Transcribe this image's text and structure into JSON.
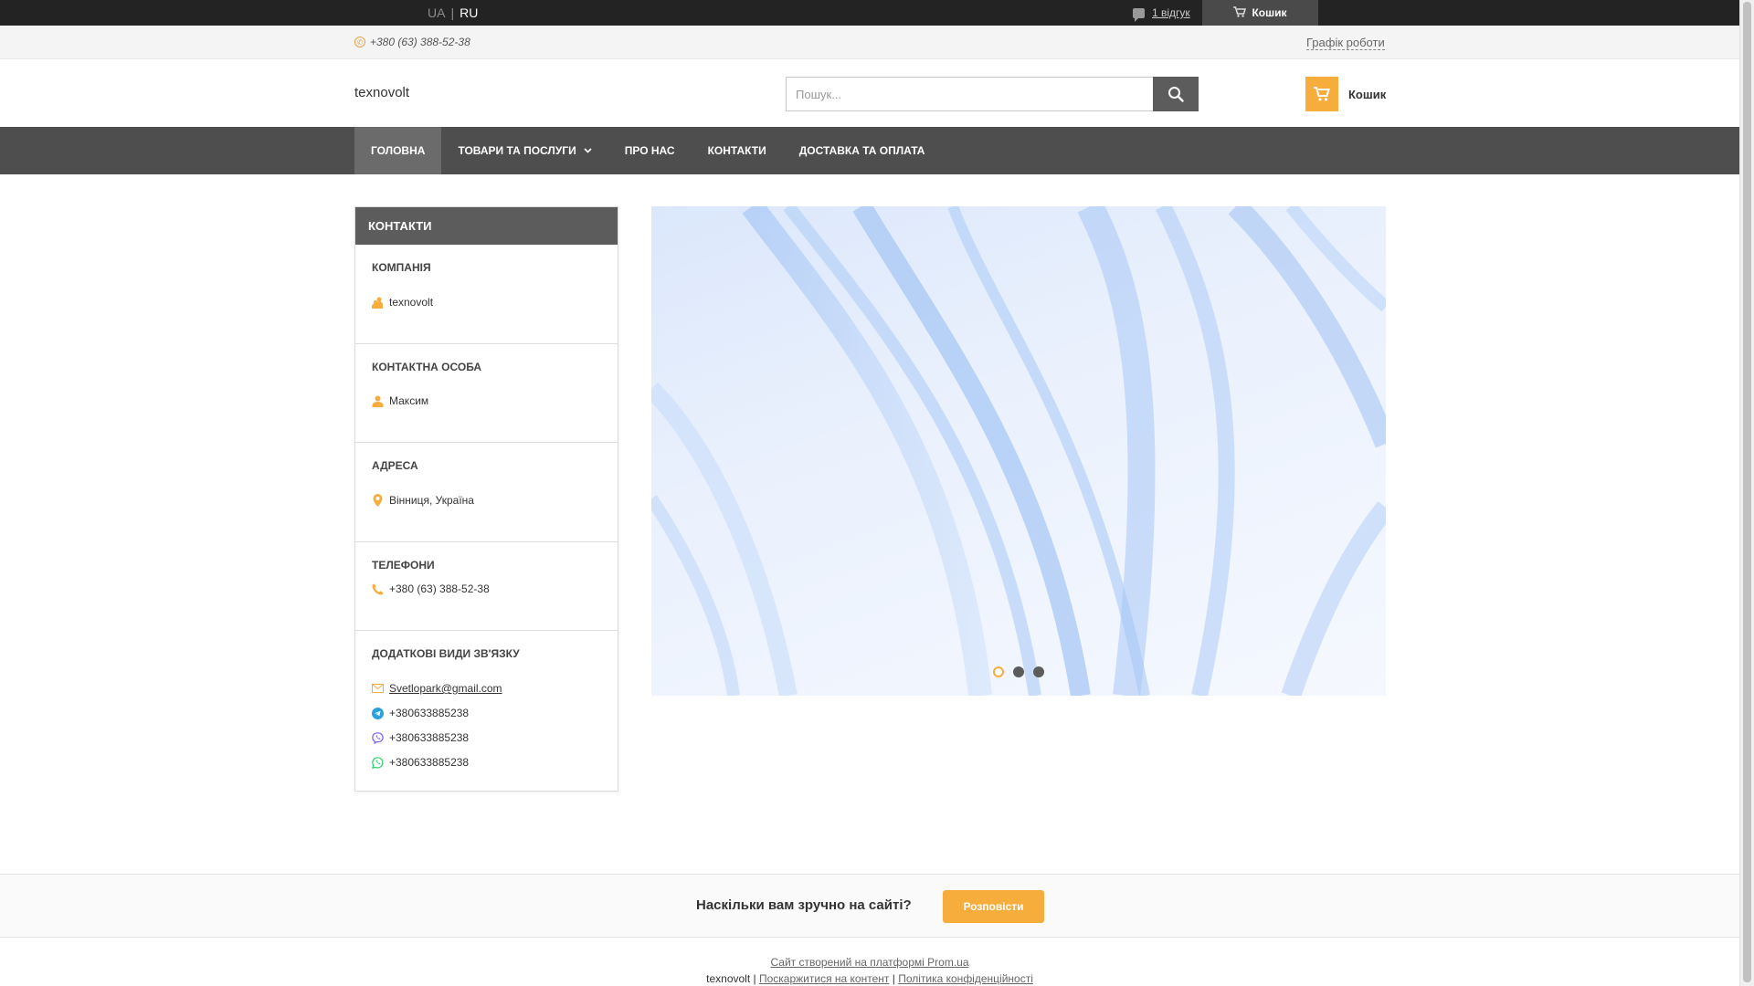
{
  "topbar": {
    "lang_ua": "UA",
    "lang_sep": "|",
    "lang_ru": "RU",
    "reviews_link": "1 відгук",
    "cart_label": "Кошик"
  },
  "phonebar": {
    "phone": "+380 (63) 388-52-38",
    "schedule": "Графік роботи"
  },
  "header": {
    "logo": "texnovolt",
    "search_placeholder": "Пошук...",
    "cart_label": "Кошик"
  },
  "nav": {
    "items": [
      {
        "label": "ГОЛОВНА",
        "active": true
      },
      {
        "label": "ТОВАРИ ТА ПОСЛУГИ",
        "dropdown": true
      },
      {
        "label": "ПРО НАС"
      },
      {
        "label": "КОНТАКТИ"
      },
      {
        "label": "ДОСТАВКА ТА ОПЛАТА"
      }
    ]
  },
  "contacts": {
    "title": "КОНТАКТИ",
    "company_heading": "КОМПАНІЯ",
    "company_name": "texnovolt",
    "person_heading": "КОНТАКТНА ОСОБА",
    "person_name": "Максим",
    "address_heading": "АДРЕСА",
    "address": "Вінниця, Україна",
    "phones_heading": "ТЕЛЕФОНИ",
    "phone": "+380 (63) 388-52-38",
    "extra_heading": "ДОДАТКОВІ ВИДИ ЗВ'ЯЗКУ",
    "email": "Svetlopark@gmail.com",
    "telegram": "+380633885238",
    "viber": "+380633885238",
    "whatsapp": "+380633885238"
  },
  "slider": {
    "active_slide": 1,
    "slide_count": 3
  },
  "feedback": {
    "question": "Наскільки вам зручно на сайті?",
    "button": "Розповісти"
  },
  "footer": {
    "created_link": "Сайт створений на платформі Prom.ua",
    "company": "texnovolt",
    "sep": "|",
    "complain_link": "Поскаржитися на контент",
    "privacy_link": "Політика конфіденційності"
  },
  "colors": {
    "accent": "#f6ad3b",
    "nav_bg": "#4e4e4e",
    "topbar_bg": "#232323"
  }
}
